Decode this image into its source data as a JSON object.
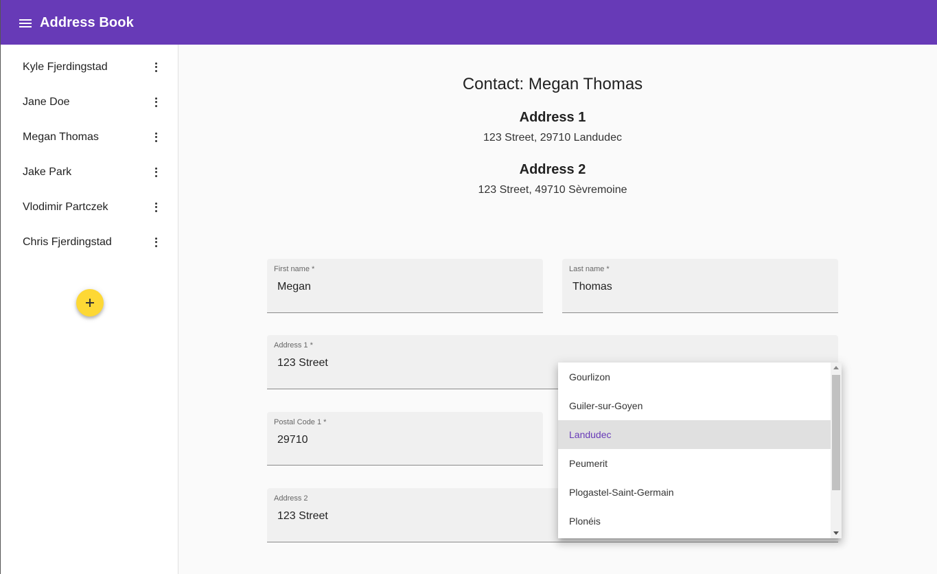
{
  "header": {
    "title": "Address Book",
    "menu_icon": "menu-icon"
  },
  "sidebar": {
    "contacts": [
      {
        "name": "Kyle Fjerdingstad"
      },
      {
        "name": "Jane Doe"
      },
      {
        "name": "Megan Thomas"
      },
      {
        "name": "Jake Park"
      },
      {
        "name": "Vlodimir Partczek"
      },
      {
        "name": "Chris Fjerdingstad"
      }
    ],
    "add_button_label": "+"
  },
  "contact": {
    "title": "Contact: Megan Thomas",
    "address1_heading": "Address 1",
    "address1_text": "123 Street, 29710 Landudec",
    "address2_heading": "Address 2",
    "address2_text": "123 Street, 49710 Sèvremoine"
  },
  "form": {
    "first_name": {
      "label": "First name *",
      "value": "Megan"
    },
    "last_name": {
      "label": "Last name *",
      "value": "Thomas"
    },
    "address1": {
      "label": "Address 1 *",
      "value": "123 Street"
    },
    "postal_code1": {
      "label": "Postal Code 1 *",
      "value": "29710"
    },
    "address2": {
      "label": "Address 2",
      "value": "123 Street"
    }
  },
  "city_dropdown": {
    "options": [
      "Gourlizon",
      "Guiler-sur-Goyen",
      "Landudec",
      "Peumerit",
      "Plogastel-Saint-Germain",
      "Plonéis"
    ],
    "selected": "Landudec"
  },
  "colors": {
    "primary": "#673ab7",
    "accent": "#fdd835",
    "field_bg": "#f0f0f0"
  }
}
